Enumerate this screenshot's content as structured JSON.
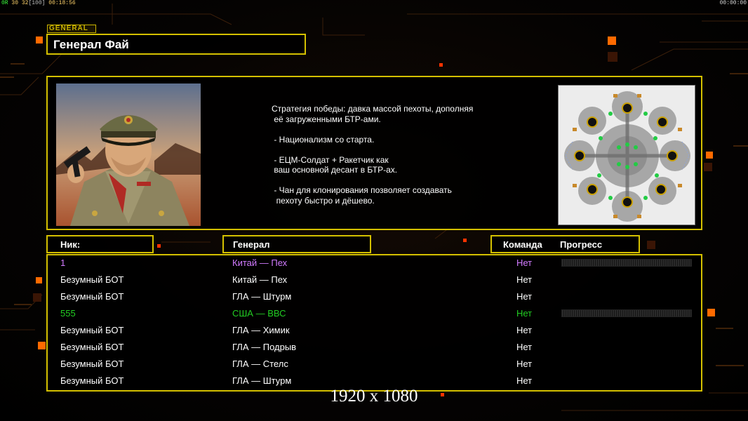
{
  "status_bar": {
    "left_ok": "0R",
    "left_mid": "30 32",
    "left_gray": "[100]",
    "left_time": "00:18:56",
    "right_time": "00:00:00"
  },
  "general_tag": "GENERAL",
  "general_name": "Генерал Фай",
  "strategy_text": "Стратегия победы: давка массой пехоты, дополняя\n её загруженными БТР-ами.\n\n - Национализм со старта.\n\n - ЕЦМ-Солдат + Ракетчик как\n ваш основной десант в БТР-ах.\n\n - Чан для клонирования позволяет создавать\n  пехоту быстро и дёшево.",
  "headers": {
    "nick": "Ник:",
    "general": "Генерал",
    "team": "Команда",
    "progress": "Прогресс"
  },
  "colors": {
    "accent": "#d4c000",
    "player1": "#d27bff",
    "player2": "#22cc22",
    "default": "#ffffff"
  },
  "players": [
    {
      "nick": "1",
      "general": "Китай — Пех",
      "team": "Нет",
      "color": "#d27bff",
      "show_progress": true
    },
    {
      "nick": "Безумный БОТ",
      "general": "Китай — Пех",
      "team": "Нет",
      "color": "#ffffff",
      "show_progress": false
    },
    {
      "nick": "Безумный БОТ",
      "general": "ГЛА — Штурм",
      "team": "Нет",
      "color": "#ffffff",
      "show_progress": false
    },
    {
      "nick": "555",
      "general": "США — ВВС",
      "team": "Нет",
      "color": "#22cc22",
      "show_progress": true
    },
    {
      "nick": "Безумный БОТ",
      "general": "ГЛА — Химик",
      "team": "Нет",
      "color": "#ffffff",
      "show_progress": false
    },
    {
      "nick": "Безумный БОТ",
      "general": "ГЛА — Подрыв",
      "team": "Нет",
      "color": "#ffffff",
      "show_progress": false
    },
    {
      "nick": "Безумный БОТ",
      "general": "ГЛА — Стелс",
      "team": "Нет",
      "color": "#ffffff",
      "show_progress": false
    },
    {
      "nick": "Безумный БОТ",
      "general": "ГЛА — Штурм",
      "team": "Нет",
      "color": "#ffffff",
      "show_progress": false
    }
  ],
  "resolution_label": "1920 x 1080",
  "icons": {
    "portrait": "general-portrait-image",
    "minimap": "map-preview-icon"
  }
}
